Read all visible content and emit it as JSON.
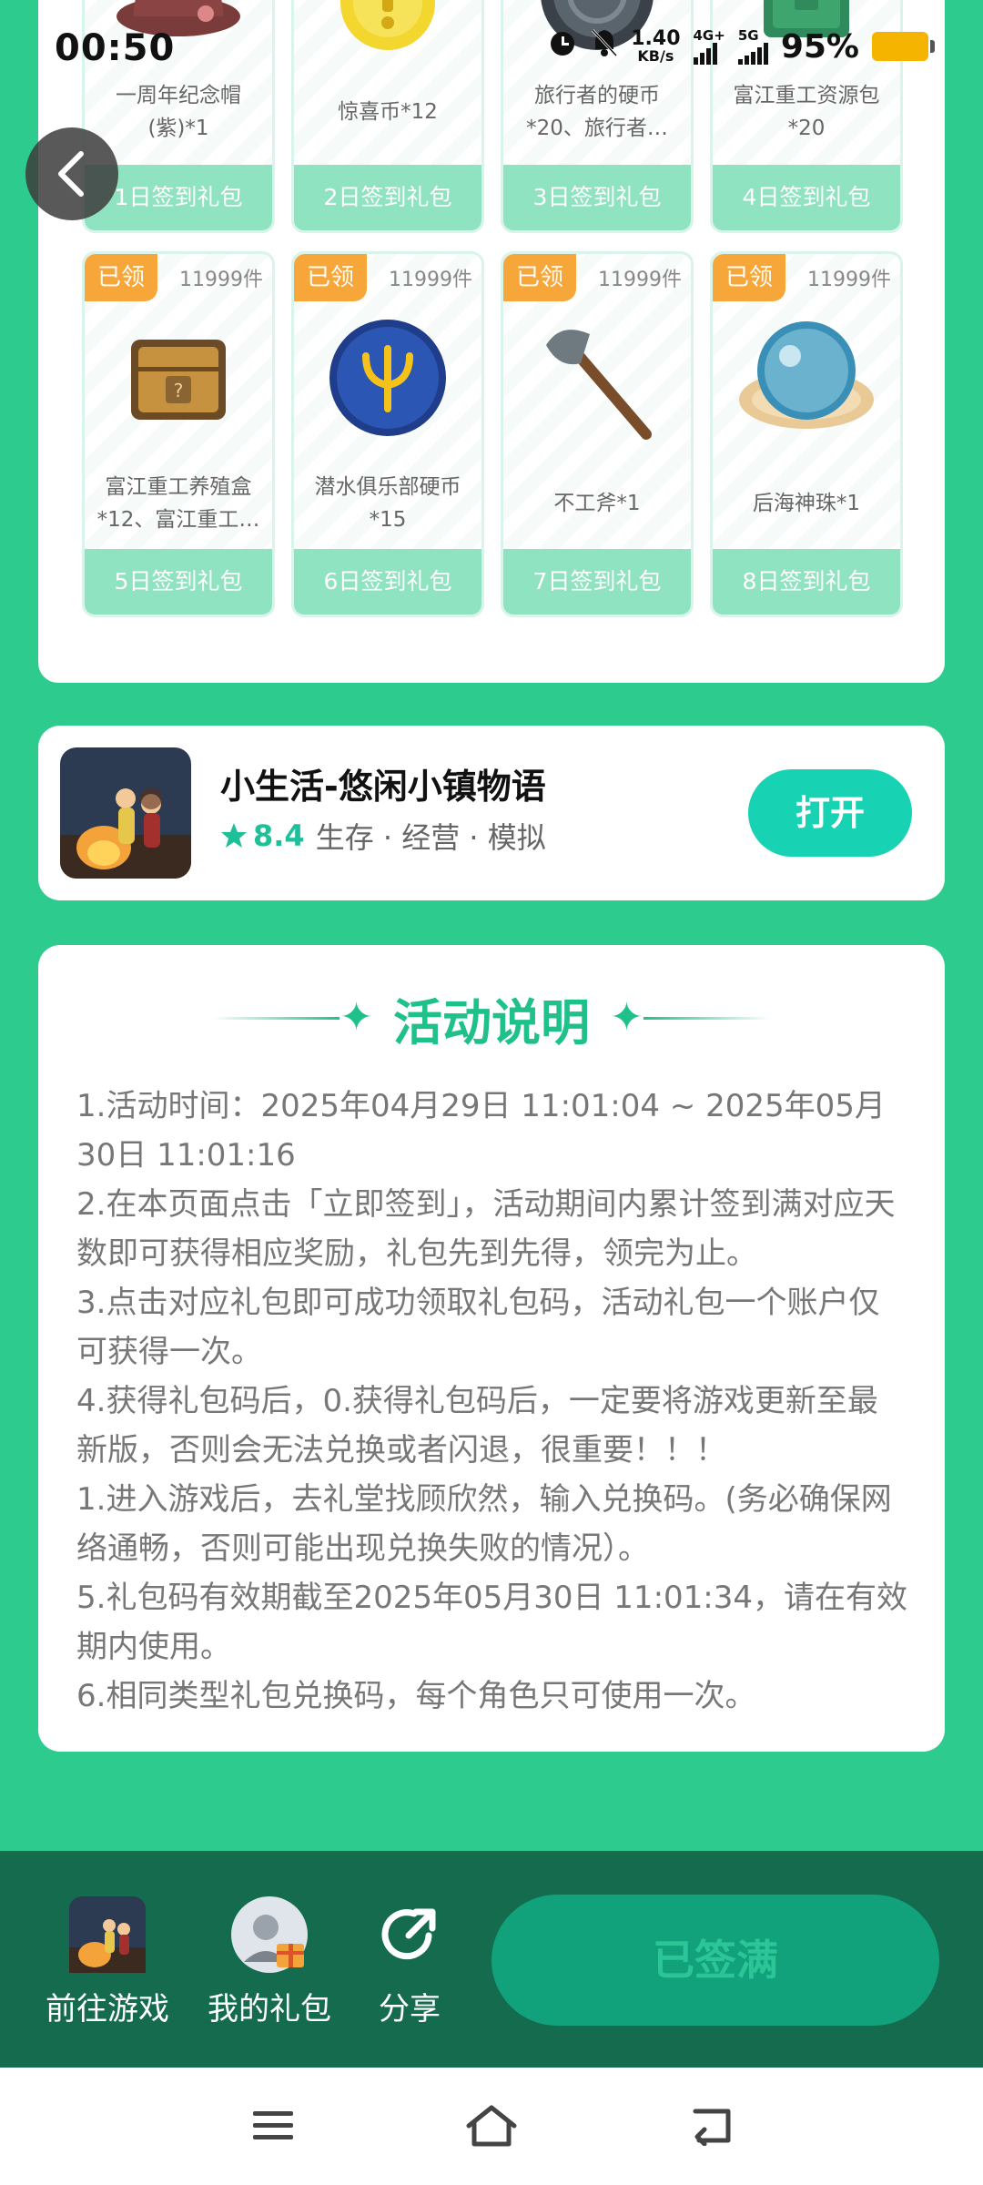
{
  "status_bar": {
    "time": "00:50",
    "net_speed_value": "1.40",
    "net_speed_unit": "KB/s",
    "sim1_label": "4G+",
    "sim2_label": "5G",
    "battery_percent": "95%",
    "battery_color": "#f5b400"
  },
  "rewards": [
    {
      "badge": "",
      "stock": "",
      "name_lines": [
        "一周年纪念帽",
        "(紫)*1"
      ],
      "day_label": "1日签到礼包",
      "icon": "cap-icon"
    },
    {
      "badge": "",
      "stock": "",
      "name_lines": [
        "惊喜币*12",
        ""
      ],
      "day_label": "2日签到礼包",
      "icon": "coin-icon"
    },
    {
      "badge": "",
      "stock": "",
      "name_lines": [
        "旅行者的硬币",
        "*20、旅行者…"
      ],
      "day_label": "3日签到礼包",
      "icon": "traveler-coin-icon"
    },
    {
      "badge": "",
      "stock": "",
      "name_lines": [
        "富江重工资源包",
        "*20"
      ],
      "day_label": "4日签到礼包",
      "icon": "resource-pack-icon"
    },
    {
      "badge": "已领",
      "stock": "11999件",
      "name_lines": [
        "富江重工养殖盒",
        "*12、富江重工…"
      ],
      "day_label": "5日签到礼包",
      "icon": "breeding-box-icon"
    },
    {
      "badge": "已领",
      "stock": "11999件",
      "name_lines": [
        "潜水俱乐部硬币",
        "*15"
      ],
      "day_label": "6日签到礼包",
      "icon": "trident-coin-icon"
    },
    {
      "badge": "已领",
      "stock": "11999件",
      "name_lines": [
        "不工斧*1",
        ""
      ],
      "day_label": "7日签到礼包",
      "icon": "axe-icon"
    },
    {
      "badge": "已领",
      "stock": "11999件",
      "name_lines": [
        "后海神珠*1",
        ""
      ],
      "day_label": "8日签到礼包",
      "icon": "pearl-icon"
    }
  ],
  "game": {
    "title": "小生活-悠闲小镇物语",
    "rating": "8.4",
    "genre": "生存 · 经营 · 模拟",
    "open_label": "打开"
  },
  "rules": {
    "title": "活动说明",
    "items": [
      "1.活动时间：2025年04月29日 11:01:04 ~ 2025年05月30日 11:01:16",
      "2.在本页面点击「立即签到」，活动期间内累计签到满对应天数即可获得相应奖励，礼包先到先得，领完为止。",
      "3.点击对应礼包即可成功领取礼包码，活动礼包一个账户仅可获得一次。",
      "4.获得礼包码后，0.获得礼包码后，一定要将游戏更新至最新版，否则会无法兑换或者闪退，很重要！！！",
      "1.进入游戏后，去礼堂找顾欣然，输入兑换码。(务必确保网络通畅，否则可能出现兑换失败的情况）。",
      "5.礼包码有效期截至2025年05月30日 11:01:34，请在有效期内使用。",
      "6.相同类型礼包兑换码，每个角色只可使用一次。"
    ]
  },
  "bottom_bar": {
    "go_game_label": "前往游戏",
    "my_gifts_label": "我的礼包",
    "share_label": "分享",
    "signed_label": "已签满"
  },
  "colors": {
    "page_bg": "#2ecb8e",
    "accent": "#20c08a",
    "day_bar": "#8fe3c1",
    "badge": "#f7a63a",
    "bottom_bar": "#146b4d",
    "open_button": "#18d2b4"
  }
}
